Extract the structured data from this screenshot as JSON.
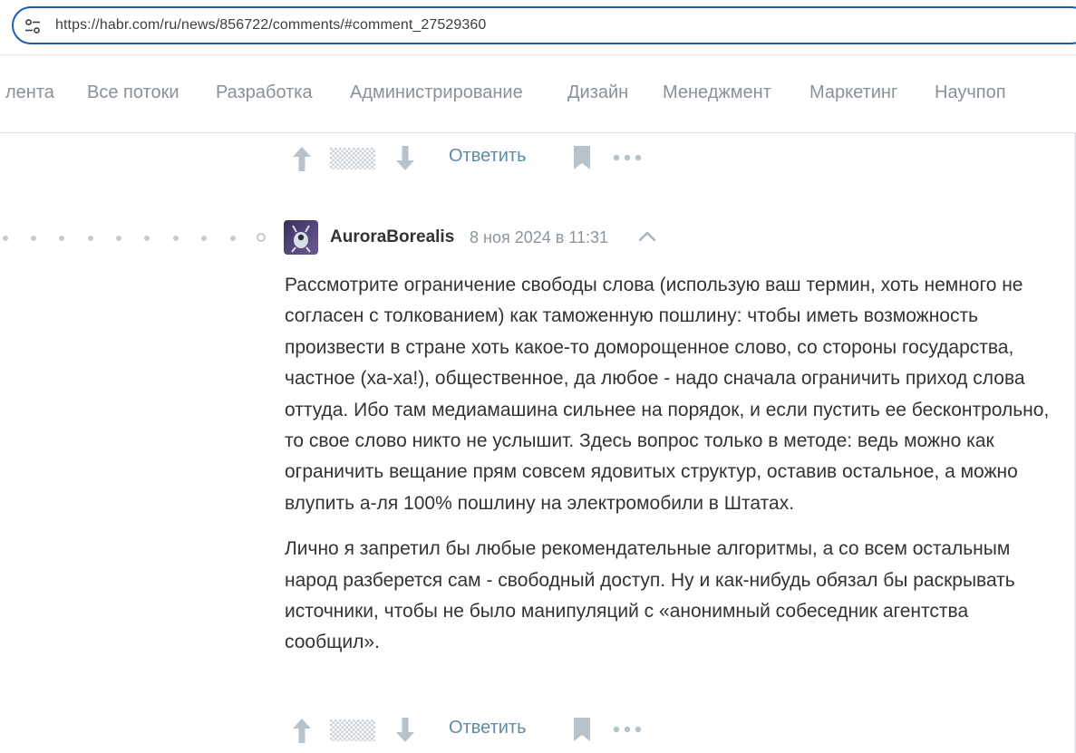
{
  "browser": {
    "url": "https://habr.com/ru/news/856722/comments/#comment_27529360"
  },
  "nav": {
    "items": [
      "лента",
      "Все потоки",
      "Разработка",
      "Администрирование",
      "Дизайн",
      "Менеджмент",
      "Маркетинг",
      "Научпоп"
    ]
  },
  "controls_top": {
    "reply_label": "Ответить"
  },
  "comment": {
    "author": "AuroraBorealis",
    "time": "8 ноя 2024 в 11:31",
    "paragraphs": [
      "Рассмотрите ограничение свободы слова (использую ваш термин, хоть немного не согласен с толкованием) как таможенную пошлину: чтобы иметь возможность произвести в стране хоть какое-то доморощенное слово, со стороны государства, частное (ха-ха!), общественное, да любое - надо сначала ограничить приход слова оттуда. Ибо там медиамашина сильнее на порядок, и если пустить ее бесконтрольно, то свое слово никто не услышит. Здесь вопрос только в методе: ведь можно как ограничить вещание прям совсем ядовитых структур, оставив остальное, а можно влупить а-ля 100% пошлину на электромобили в Штатах.",
      "Лично я запретил бы любые рекомендательные алгоритмы, а со всем остальным народ разберется сам - свободный доступ. Ну и как-нибудь обязал бы раскрывать источники, чтобы не было манипуляций с «анонимный собеседник агентства сообщил»."
    ],
    "reply_label": "Ответить"
  },
  "icons": {
    "site_info": "tune-icon",
    "vote_up": "arrow-up-icon",
    "vote_down": "arrow-down-icon",
    "bookmark": "bookmark-icon",
    "more": "more-dots-icon",
    "collapse": "chevron-up-icon"
  },
  "colors": {
    "address_border": "#1a5fb4",
    "reply_link": "#5e8ba8",
    "icon_gray": "#b8c2cb",
    "nav_text": "#8a9197"
  }
}
